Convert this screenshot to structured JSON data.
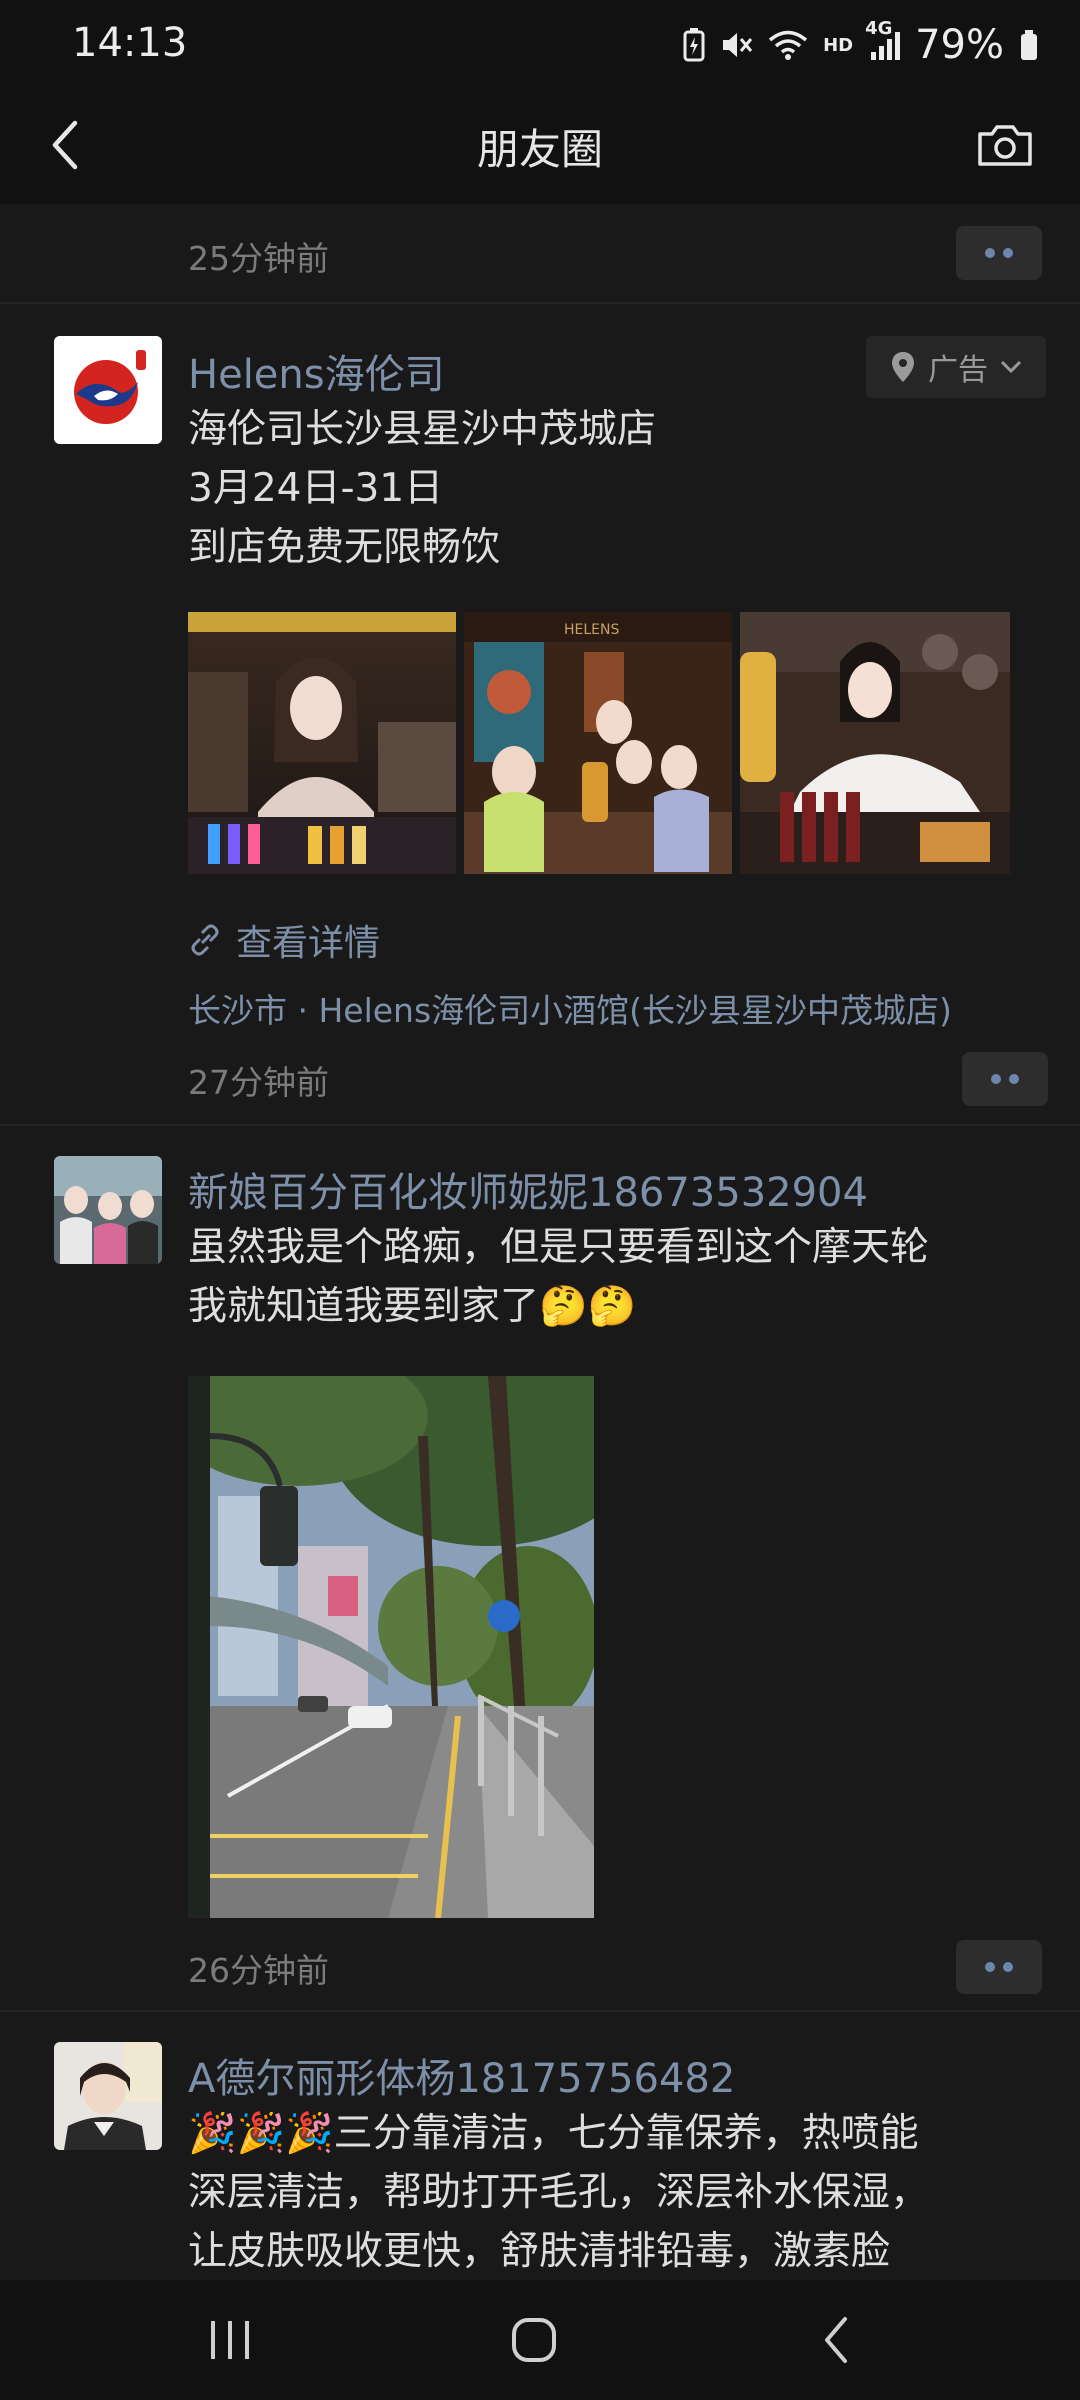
{
  "status_bar": {
    "time": "14:13",
    "network": "4G",
    "hd": "HD",
    "battery_percent": "79%"
  },
  "nav": {
    "title": "朋友圈",
    "back_icon": "chevron-left-icon",
    "camera_icon": "camera-icon"
  },
  "feed": {
    "previous_post_time": "25分钟前",
    "posts": [
      {
        "nickname": "Helens海伦司",
        "ad_label": "广告",
        "content_lines": [
          "海伦司长沙县星沙中茂城店",
          "3月24日-31日",
          "到店免费无限畅饮"
        ],
        "photo_brand_text": "HELENS",
        "link_text": "查看详情",
        "location": "长沙市 · Helens海伦司小酒馆(长沙县星沙中茂城店)",
        "time": "27分钟前"
      },
      {
        "nickname": "新娘百分百化妆师妮妮18673532904",
        "content_lines": [
          "虽然我是个路痴，但是只要看到这个摩天轮",
          "我就知道我要到家了🤔🤔"
        ],
        "time": "26分钟前"
      },
      {
        "nickname": "A德尔丽形体杨18175756482",
        "content_lines": [
          "🎉🎉🎉三分靠清洁，七分靠保养，热喷能",
          "深层清洁，帮助打开毛孔，深层补水保湿，",
          "让皮肤吸收更快，舒肤清排铅毒，激素脸"
        ]
      }
    ]
  },
  "colors": {
    "background": "#191919",
    "bar_background": "#111111",
    "nickname_link": "#7d90a9",
    "body_text": "#dedede",
    "timestamp": "#7b7b7b"
  }
}
